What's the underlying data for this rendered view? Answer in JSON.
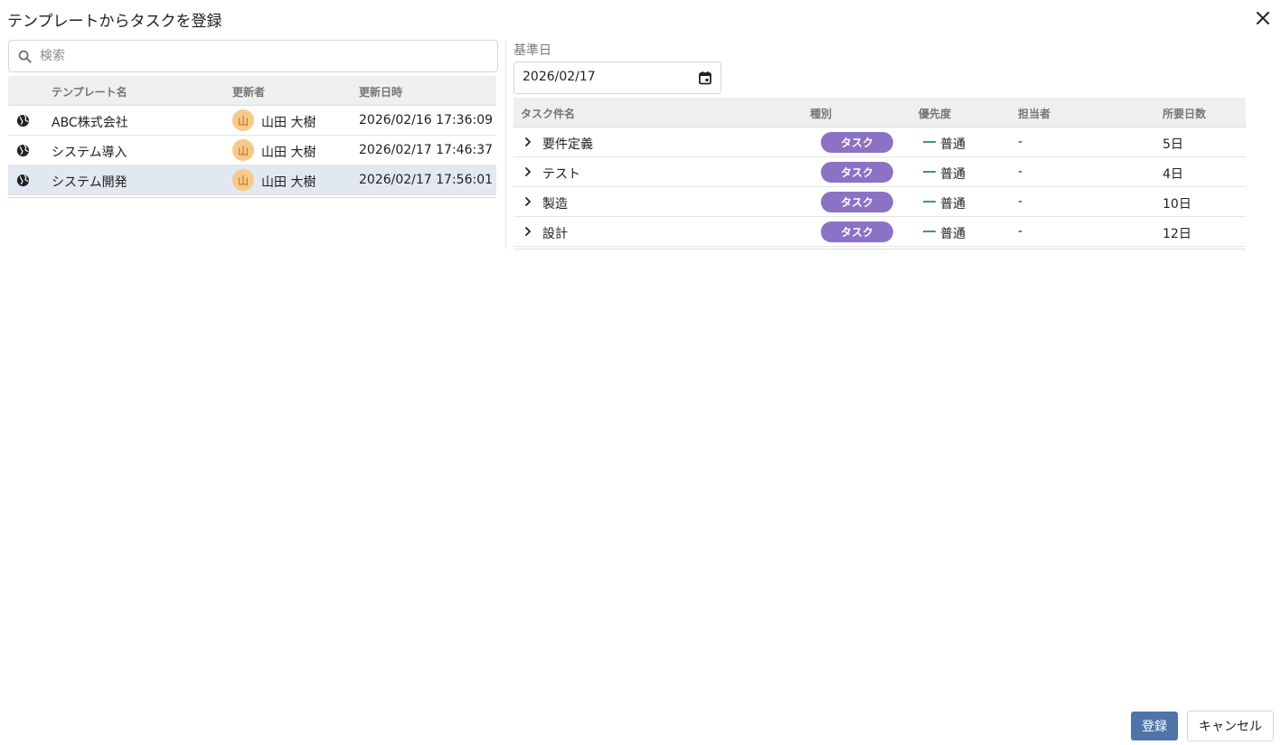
{
  "dialog": {
    "title": "テンプレートからタスクを登録",
    "close_icon": "close-icon"
  },
  "search": {
    "placeholder": "検索",
    "value": "",
    "icon": "search-icon"
  },
  "template_table": {
    "headers": [
      "テンプレート名",
      "更新者",
      "更新日時"
    ],
    "rows": [
      {
        "name": "ABC株式会社",
        "avatar": "山",
        "updater": "山田 大樹",
        "updated": "2026/02/16 17:36:09",
        "selected": false,
        "icon": "globe-icon"
      },
      {
        "name": "システム導入",
        "avatar": "山",
        "updater": "山田 大樹",
        "updated": "2026/02/17 17:46:37",
        "selected": false,
        "icon": "globe-icon"
      },
      {
        "name": "システム開発",
        "avatar": "山",
        "updater": "山田 大樹",
        "updated": "2026/02/17 17:56:01",
        "selected": true,
        "icon": "globe-icon"
      }
    ]
  },
  "base_date": {
    "label": "基準日",
    "value": "2026/02/17",
    "icon": "calendar-icon"
  },
  "task_table": {
    "headers": [
      "タスク件名",
      "種別",
      "優先度",
      "担当者",
      "所要日数"
    ],
    "rows": [
      {
        "name": "要件定義",
        "type": "タスク",
        "priority": "普通",
        "assignee": "-",
        "days": "5日"
      },
      {
        "name": "テスト",
        "type": "タスク",
        "priority": "普通",
        "assignee": "-",
        "days": "4日"
      },
      {
        "name": "製造",
        "type": "タスク",
        "priority": "普通",
        "assignee": "-",
        "days": "10日"
      },
      {
        "name": "設計",
        "type": "タスク",
        "priority": "普通",
        "assignee": "-",
        "days": "12日"
      }
    ]
  },
  "buttons": {
    "register": "登録",
    "cancel": "キャンセル"
  },
  "colors": {
    "badge": "#8b72c5",
    "priority_normal": "#3d9a6e",
    "primary_button": "#4f74aa",
    "selected_row": "#e1e8f1",
    "avatar_bg": "#f8c98a"
  }
}
